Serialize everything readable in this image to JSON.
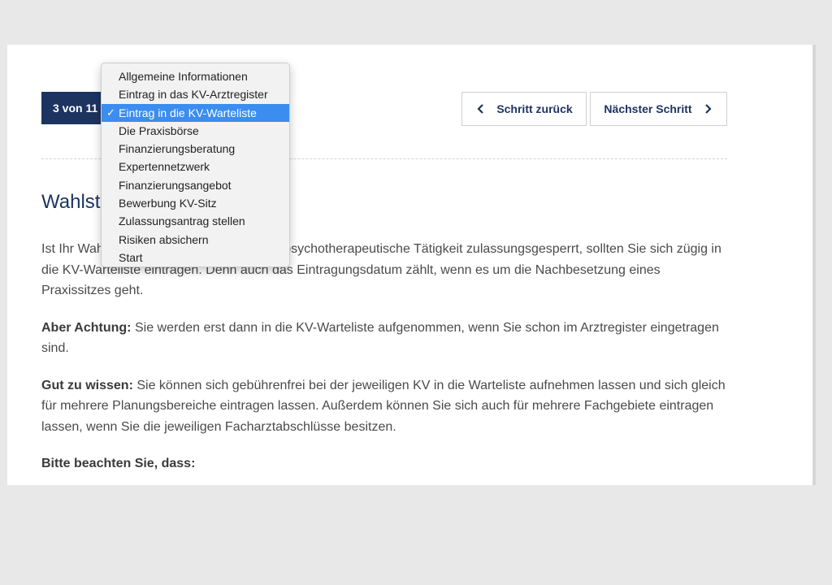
{
  "step": {
    "counter": "3 von 11"
  },
  "nav": {
    "back_label": "Schritt zurück",
    "next_label": "Nächster Schritt"
  },
  "heading": "Wahlst",
  "dropdown": {
    "selected_index": 2,
    "check_mark": "✓",
    "items": [
      "Allgemeine Informationen",
      "Eintrag in das KV-Arztregister",
      "Eintrag in die KV-Warteliste",
      "Die Praxisbörse",
      "Finanzierungsberatung",
      "Expertennetzwerk",
      "Finanzierungsangebot",
      "Bewerbung KV-Sitz",
      "Zulassungsantrag stellen",
      "Risiken absichern",
      "Start"
    ]
  },
  "content": {
    "p1": "Ist Ihr Wahlstandort für Ihre ärztliche oder psychotherapeutische Tätigkeit zulassungsgesperrt, sollten Sie sich zügig in die KV-Warteliste eintragen. Denn auch das Eintragungsdatum zählt, wenn es um die Nachbesetzung eines Praxissitzes geht.",
    "p2_bold": "Aber Achtung:",
    "p2_text": " Sie werden erst dann in die KV-Warteliste aufgenommen, wenn Sie schon im Arztregister eingetragen sind.",
    "p3_bold": "Gut zu wissen:",
    "p3_text": " Sie können sich gebührenfrei bei der jeweiligen KV in die Warteliste aufnehmen lassen und sich gleich für mehrere Planungsbereiche eintragen lassen. Außerdem können Sie sich auch für mehrere Fachgebiete eintragen lassen, wenn Sie die jeweiligen Facharztabschlüsse besitzen.",
    "p4_bold": "Bitte beachten Sie, dass:"
  },
  "colors": {
    "brand": "#1d3461",
    "selection": "#3b8df0"
  }
}
